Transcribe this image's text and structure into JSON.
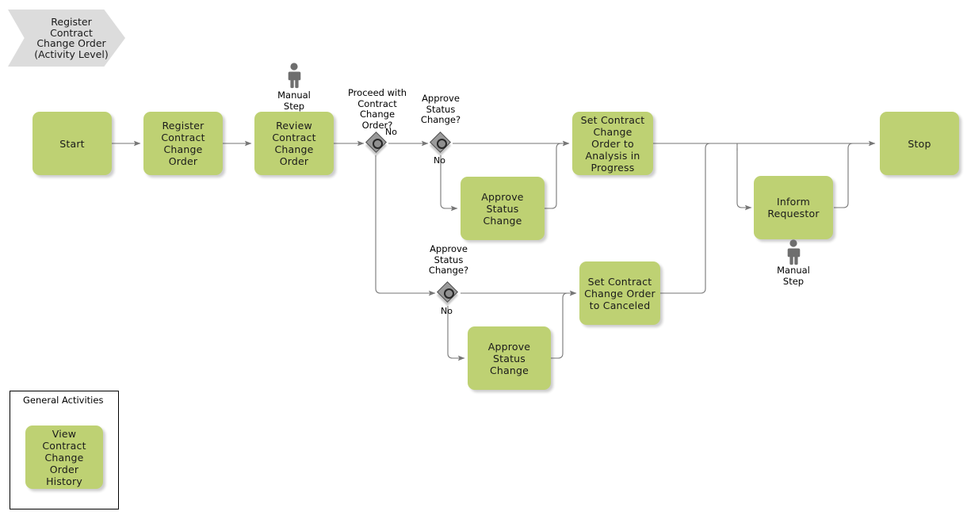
{
  "diagram": {
    "title": "Register Contract Change Order (Activity Level)",
    "pool_header": "Register\nContract\nChange Order\n(Activity Level)",
    "colors": {
      "activity_fill": "#bed173",
      "pool_fill": "#dcdcdc",
      "gateway_fill": "#9a9a9a",
      "gateway_border": "#4d4d4d",
      "connector": "#767676",
      "text": "#1a1a1a"
    }
  },
  "nodes": {
    "start": {
      "label": "Start",
      "type": "start-event"
    },
    "register": {
      "label": "Register\nContract\nChange Order",
      "type": "task"
    },
    "review": {
      "label": "Review\nContract\nChange Order",
      "type": "task"
    },
    "set_analysis": {
      "label": "Set Contract\nChange\nOrder to\nAnalysis in\nProgress",
      "type": "task"
    },
    "approve_status_change_top": {
      "label": "Approve Status\nChange",
      "type": "task"
    },
    "approve_status_change_bottom": {
      "label": "Approve Status\nChange",
      "type": "task"
    },
    "set_canceled": {
      "label": "Set Contract\nChange Order\nto Canceled",
      "type": "task"
    },
    "inform_requestor": {
      "label": "Inform\nRequestor",
      "type": "task"
    },
    "stop": {
      "label": "Stop",
      "type": "end-event"
    },
    "view_history": {
      "label": "View Contract\nChange Order\nHistory",
      "type": "task"
    }
  },
  "gateways": {
    "proceed": {
      "question": "Proceed with\nContract\nChange\nOrder?",
      "no_label": "No"
    },
    "approve_top": {
      "question": "Approve\nStatus\nChange?",
      "no_label": "No"
    },
    "approve_bottom": {
      "question": "Approve\nStatus\nChange?",
      "no_label": "No"
    }
  },
  "markers": {
    "manual_step_review": "Manual\nStep",
    "manual_step_inform": "Manual\nStep"
  },
  "legend": {
    "title": "General Activities"
  }
}
